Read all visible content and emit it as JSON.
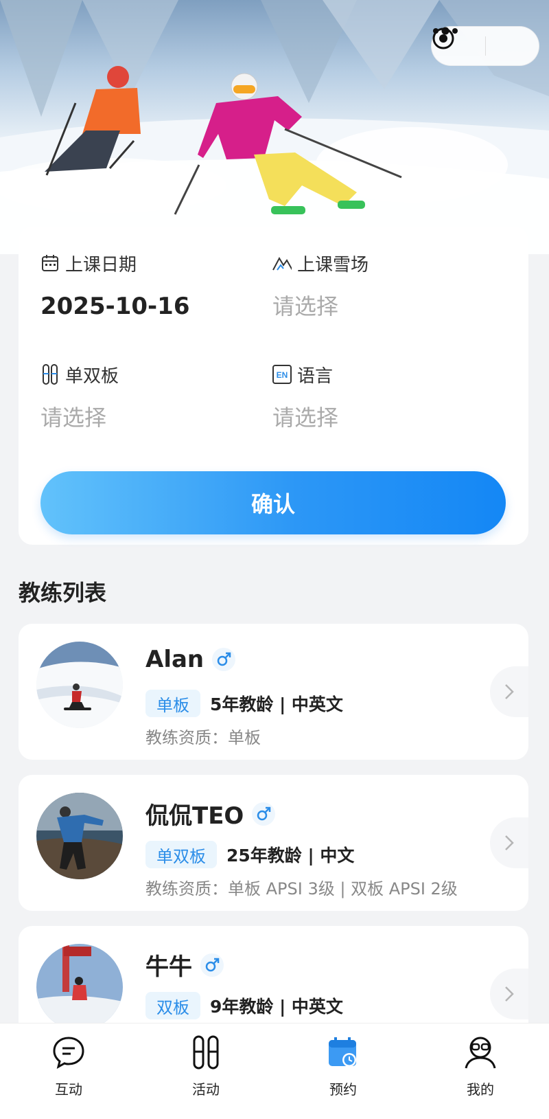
{
  "filter": {
    "date_label": "上课日期",
    "date_value": "2025-10-16",
    "resort_label": "上课雪场",
    "resort_value": "请选择",
    "board_label": "单双板",
    "board_value": "请选择",
    "language_label": "语言",
    "language_value": "请选择",
    "language_icon_text": "EN",
    "confirm_label": "确认"
  },
  "section_title": "教练列表",
  "coaches": [
    {
      "name": "Alan",
      "gender_symbol": "♂",
      "board_tag": "单板",
      "meta": "5年教龄 | 中英文",
      "qualification": "教练资质：单板"
    },
    {
      "name": "侃侃TEO",
      "gender_symbol": "♂",
      "board_tag": "单双板",
      "meta": "25年教龄 | 中文",
      "qualification": "教练资质：单板 APSI 3级 | 双板 APSI 2级"
    },
    {
      "name": "牛牛",
      "gender_symbol": "♂",
      "board_tag": "双板",
      "meta": "9年教龄 | 中英文",
      "qualification": ""
    }
  ],
  "tabbar": {
    "items": [
      {
        "label": "互动",
        "icon": "chat-icon"
      },
      {
        "label": "活动",
        "icon": "ski-icon"
      },
      {
        "label": "预约",
        "icon": "calendar-clock-icon"
      },
      {
        "label": "我的",
        "icon": "profile-icon"
      }
    ],
    "active_index": 2
  },
  "colors": {
    "accent": "#1487f5",
    "tag_text": "#2b8de8",
    "tag_bg": "#eaf5fd"
  }
}
